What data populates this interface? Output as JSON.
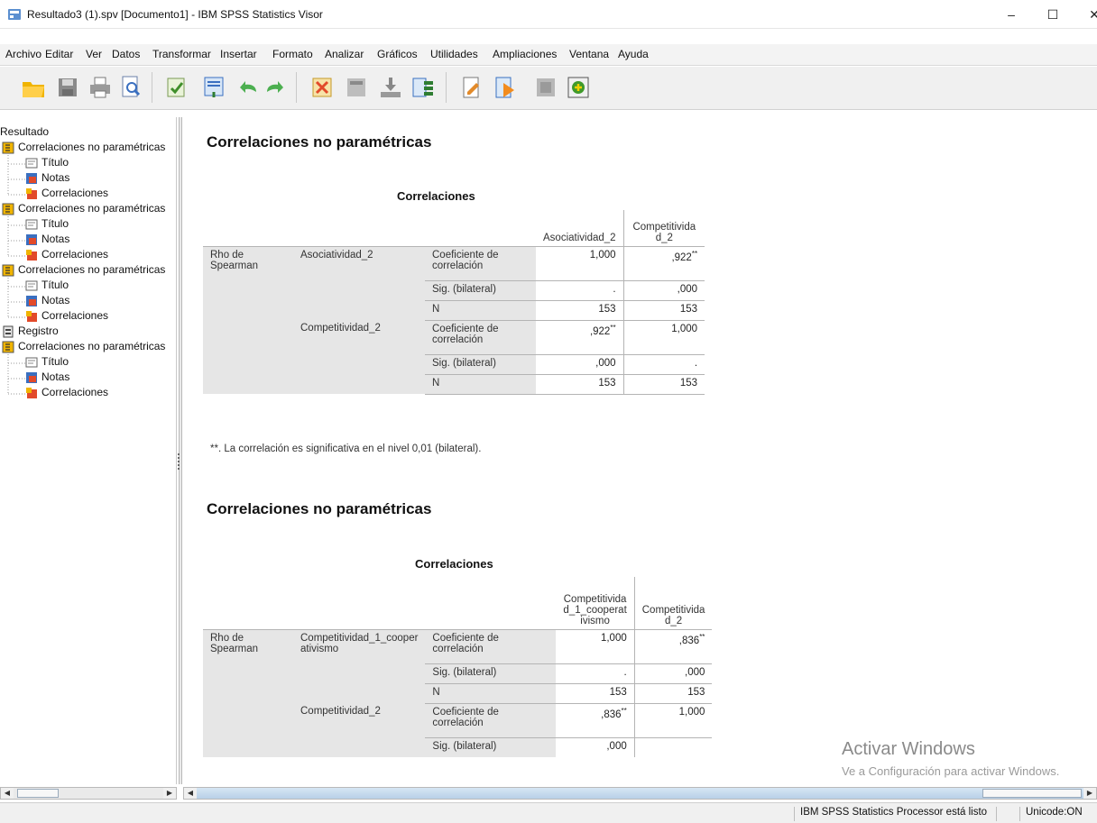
{
  "window": {
    "title": "Resultado3 (1).spv [Documento1] - IBM SPSS Statistics Visor",
    "minimize": "–",
    "maximize": "☐",
    "close": "✕"
  },
  "menu": [
    "Archivo",
    "Editar",
    "Ver",
    "Datos",
    "Transformar",
    "Insertar",
    "Formato",
    "Analizar",
    "Gráficos",
    "Utilidades",
    "Ampliaciones",
    "Ventana",
    "Ayuda"
  ],
  "toolbar_icons": [
    "open-icon",
    "save-icon",
    "print-icon",
    "print-preview-icon",
    "export-icon",
    "recall-dialog-icon",
    "undo-icon",
    "redo-icon",
    "goto-data-icon",
    "goto-case-icon",
    "goto-variable-icon",
    "variables-icon",
    "insert-output-icon",
    "designate-window-icon",
    "hide-icon",
    "add-icon"
  ],
  "outline": {
    "root": "Resultado",
    "groups": [
      {
        "label": "Correlaciones no paramétricas",
        "children": [
          "Título",
          "Notas",
          "Correlaciones"
        ]
      },
      {
        "label": "Correlaciones no paramétricas",
        "children": [
          "Título",
          "Notas",
          "Correlaciones"
        ]
      },
      {
        "label": "Correlaciones no paramétricas",
        "children": [
          "Título",
          "Notas",
          "Correlaciones"
        ]
      },
      {
        "label": "Registro",
        "children": []
      },
      {
        "label": "Correlaciones no paramétricas",
        "children": [
          "Título",
          "Notas",
          "Correlaciones"
        ]
      }
    ]
  },
  "output": [
    {
      "heading": "Correlaciones no paramétricas",
      "table_title": "Correlaciones",
      "col_headers": [
        "Asociatividad_2",
        "Competitivida d_2"
      ],
      "row_group": "Rho de Spearman",
      "rows": [
        {
          "var": "Asociatividad_2",
          "stat": "Coeficiente de correlación",
          "v1": "1,000",
          "v2": ",922",
          "sup2": "**"
        },
        {
          "var": "",
          "stat": "Sig. (bilateral)",
          "v1": ".",
          "v2": ",000"
        },
        {
          "var": "",
          "stat": "N",
          "v1": "153",
          "v2": "153"
        },
        {
          "var": "Competitividad_2",
          "stat": "Coeficiente de correlación",
          "v1": ",922",
          "sup1": "**",
          "v2": "1,000"
        },
        {
          "var": "",
          "stat": "Sig. (bilateral)",
          "v1": ",000",
          "v2": "."
        },
        {
          "var": "",
          "stat": "N",
          "v1": "153",
          "v2": "153"
        }
      ],
      "footnote": "**. La correlación es significativa en el nivel 0,01 (bilateral)."
    },
    {
      "heading": "Correlaciones no paramétricas",
      "table_title": "Correlaciones",
      "col_headers": [
        "Competitivida d_1_cooperat ivismo",
        "Competitivida d_2"
      ],
      "row_group": "Rho de Spearman",
      "rows": [
        {
          "var": "Competitividad_1_cooper ativismo",
          "stat": "Coeficiente de correlación",
          "v1": "1,000",
          "v2": ",836",
          "sup2": "**"
        },
        {
          "var": "",
          "stat": "Sig. (bilateral)",
          "v1": ".",
          "v2": ",000"
        },
        {
          "var": "",
          "stat": "N",
          "v1": "153",
          "v2": "153"
        },
        {
          "var": "Competitividad_2",
          "stat": "Coeficiente de correlación",
          "v1": ",836",
          "sup1": "**",
          "v2": "1,000"
        },
        {
          "var": "",
          "stat": "Sig. (bilateral)",
          "v1": ",000",
          "v2": ""
        }
      ]
    }
  ],
  "watermark": {
    "title": "Activar Windows",
    "subtitle": "Ve a Configuración para activar Windows."
  },
  "status": {
    "processor": "IBM SPSS Statistics Processor está listo",
    "unicode": "Unicode:ON"
  },
  "colors": {
    "accent": "#f0b400",
    "row_label_bg": "#e6e6e6",
    "scroll_blue": "#b8d0e8"
  }
}
